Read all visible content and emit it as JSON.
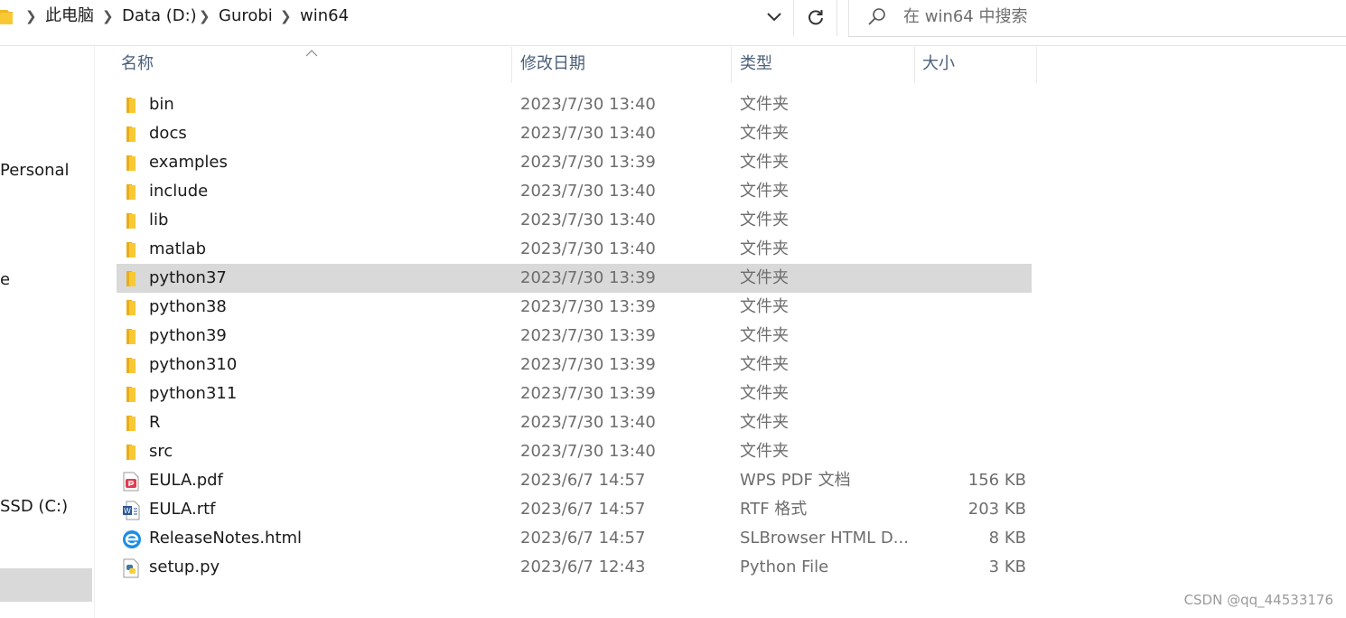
{
  "address_bar": {
    "crumbs": [
      "此电脑",
      "Data (D:)",
      "Gurobi",
      "win64"
    ]
  },
  "search": {
    "placeholder": "在 win64 中搜索"
  },
  "nav": {
    "items": [
      "Personal",
      "e",
      "SSD (C:)"
    ]
  },
  "columns": {
    "name": "名称",
    "date": "修改日期",
    "type": "类型",
    "size": "大小"
  },
  "files": [
    {
      "name": "bin",
      "date": "2023/7/30 13:40",
      "type": "文件夹",
      "size": "",
      "icon": "folder-icon"
    },
    {
      "name": "docs",
      "date": "2023/7/30 13:40",
      "type": "文件夹",
      "size": "",
      "icon": "folder-icon"
    },
    {
      "name": "examples",
      "date": "2023/7/30 13:39",
      "type": "文件夹",
      "size": "",
      "icon": "folder-icon"
    },
    {
      "name": "include",
      "date": "2023/7/30 13:40",
      "type": "文件夹",
      "size": "",
      "icon": "folder-icon"
    },
    {
      "name": "lib",
      "date": "2023/7/30 13:40",
      "type": "文件夹",
      "size": "",
      "icon": "folder-icon"
    },
    {
      "name": "matlab",
      "date": "2023/7/30 13:40",
      "type": "文件夹",
      "size": "",
      "icon": "folder-icon"
    },
    {
      "name": "python37",
      "date": "2023/7/30 13:39",
      "type": "文件夹",
      "size": "",
      "icon": "folder-icon",
      "selected": true
    },
    {
      "name": "python38",
      "date": "2023/7/30 13:39",
      "type": "文件夹",
      "size": "",
      "icon": "folder-icon"
    },
    {
      "name": "python39",
      "date": "2023/7/30 13:39",
      "type": "文件夹",
      "size": "",
      "icon": "folder-icon"
    },
    {
      "name": "python310",
      "date": "2023/7/30 13:39",
      "type": "文件夹",
      "size": "",
      "icon": "folder-icon"
    },
    {
      "name": "python311",
      "date": "2023/7/30 13:39",
      "type": "文件夹",
      "size": "",
      "icon": "folder-icon"
    },
    {
      "name": "R",
      "date": "2023/7/30 13:40",
      "type": "文件夹",
      "size": "",
      "icon": "folder-icon"
    },
    {
      "name": "src",
      "date": "2023/7/30 13:40",
      "type": "文件夹",
      "size": "",
      "icon": "folder-icon"
    },
    {
      "name": "EULA.pdf",
      "date": "2023/6/7 14:57",
      "type": "WPS PDF 文档",
      "size": "156 KB",
      "icon": "pdf-file-icon"
    },
    {
      "name": "EULA.rtf",
      "date": "2023/6/7 14:57",
      "type": "RTF 格式",
      "size": "203 KB",
      "icon": "word-file-icon"
    },
    {
      "name": "ReleaseNotes.html",
      "date": "2023/6/7 14:57",
      "type": "SLBrowser HTML D...",
      "size": "8 KB",
      "icon": "browser-html-icon"
    },
    {
      "name": "setup.py",
      "date": "2023/6/7 12:43",
      "type": "Python File",
      "size": "3 KB",
      "icon": "python-file-icon"
    }
  ],
  "watermark": "CSDN @qq_44533176",
  "colors": {
    "folder": "#f8c934",
    "selection": "#d9d9d9",
    "header_text": "#4c607a",
    "secondary_text": "#6d6d6d"
  }
}
